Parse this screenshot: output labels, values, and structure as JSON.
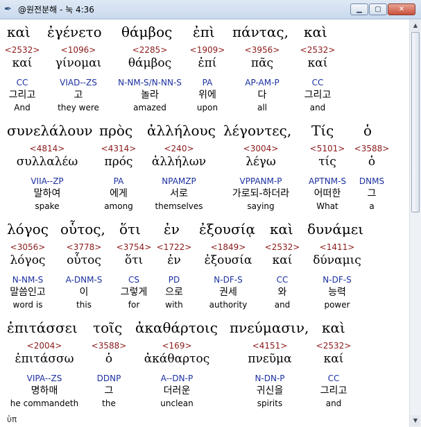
{
  "window": {
    "title": "@원전분해 - 눅 4:36",
    "icon": "quill-pen-icon",
    "minimize_glyph": "▁",
    "maximize_glyph": "▢",
    "close_glyph": "✕"
  },
  "scrollbar": {
    "up_glyph": "▲",
    "down_glyph": "▼"
  },
  "lines": [
    {
      "text": [
        "καὶ",
        "ἐγένετο",
        "θάμβος",
        "ἐπὶ",
        "πάντας,",
        "καὶ"
      ],
      "words": [
        {
          "strong": "<2532>",
          "lemma": "καί",
          "morph": "CC",
          "korean": "그리고",
          "english": "And"
        },
        {
          "strong": "<1096>",
          "lemma": "γίνομαι",
          "morph": "VIAD--ZS",
          "korean": "고",
          "english": "they were"
        },
        {
          "strong": "<2285>",
          "lemma": "θάμβος",
          "morph": "N-NM-S/N-NN-S",
          "korean": "놀라",
          "english": "amazed"
        },
        {
          "strong": "<1909>",
          "lemma": "ἐπί",
          "morph": "PA",
          "korean": "위에",
          "english": "upon"
        },
        {
          "strong": "<3956>",
          "lemma": "πᾶς",
          "morph": "AP-AM-P",
          "korean": "다",
          "english": "all"
        },
        {
          "strong": "<2532>",
          "lemma": "καί",
          "morph": "CC",
          "korean": "그리고",
          "english": "and"
        }
      ]
    },
    {
      "text": [
        "συνελάλουν",
        "πρὸς",
        "ἀλλήλους",
        "λέγοντες,",
        "Τίς",
        "ὁ"
      ],
      "words": [
        {
          "strong": "<4814>",
          "lemma": "συλλαλέω",
          "morph": "VIIA--ZP",
          "korean": "말하여",
          "english": "spake"
        },
        {
          "strong": "<4314>",
          "lemma": "πρός",
          "morph": "PA",
          "korean": "에게",
          "english": "among"
        },
        {
          "strong": "<240>",
          "lemma": "ἀλλήλων",
          "morph": "NPAMZP",
          "korean": "서로",
          "english": "themselves"
        },
        {
          "strong": "<3004>",
          "lemma": "λέγω",
          "morph": "VPPANM-P",
          "korean": "가로되-하더라",
          "english": "saying"
        },
        {
          "strong": "<5101>",
          "lemma": "τίς",
          "morph": "APTNM-S",
          "korean": "어떠한",
          "english": "What"
        },
        {
          "strong": "<3588>",
          "lemma": "ὁ",
          "morph": "DNMS",
          "korean": "그",
          "english": "a"
        }
      ]
    },
    {
      "text": [
        "λόγος",
        "οὗτος,",
        "ὅτι",
        "ἐν",
        "ἐξουσίᾳ",
        "καὶ",
        "δυνάμει"
      ],
      "words": [
        {
          "strong": "<3056>",
          "lemma": "λόγος",
          "morph": "N-NM-S",
          "korean": "말씀인고",
          "english": "word is"
        },
        {
          "strong": "<3778>",
          "lemma": "οὗτος",
          "morph": "A-DNM-S",
          "korean": "이",
          "english": "this"
        },
        {
          "strong": "<3754>",
          "lemma": "ὅτι",
          "morph": "CS",
          "korean": "그렇게",
          "english": "for"
        },
        {
          "strong": "<1722>",
          "lemma": "ἐν",
          "morph": "PD",
          "korean": "으로",
          "english": "with"
        },
        {
          "strong": "<1849>",
          "lemma": "ἐξουσία",
          "morph": "N-DF-S",
          "korean": "권세",
          "english": "authority"
        },
        {
          "strong": "<2532>",
          "lemma": "καί",
          "morph": "CC",
          "korean": "와",
          "english": "and"
        },
        {
          "strong": "<1411>",
          "lemma": "δύναμις",
          "morph": "N-DF-S",
          "korean": "능력",
          "english": "power"
        }
      ]
    },
    {
      "text": [
        "ἐπιτάσσει",
        "τοῖς",
        "ἀκαθάρτοις",
        "πνεύμασιν,",
        "καὶ"
      ],
      "words": [
        {
          "strong": "<2004>",
          "lemma": "ἐπιτάσσω",
          "morph": "VIPA--ZS",
          "korean": "명하매",
          "english": "he commandeth"
        },
        {
          "strong": "<3588>",
          "lemma": "ὁ",
          "morph": "DDNP",
          "korean": "그",
          "english": "the"
        },
        {
          "strong": "<169>",
          "lemma": "ἀκάθαρτος",
          "morph": "A--DN-P",
          "korean": "더러운",
          "english": "unclean"
        },
        {
          "strong": "<4151>",
          "lemma": "πνεῦμα",
          "morph": "N-DN-P",
          "korean": "귀신을",
          "english": "spirits"
        },
        {
          "strong": "<2532>",
          "lemma": "καί",
          "morph": "CC",
          "korean": "그리고",
          "english": "and"
        }
      ]
    }
  ],
  "bottom_fragment": "ὑπ"
}
